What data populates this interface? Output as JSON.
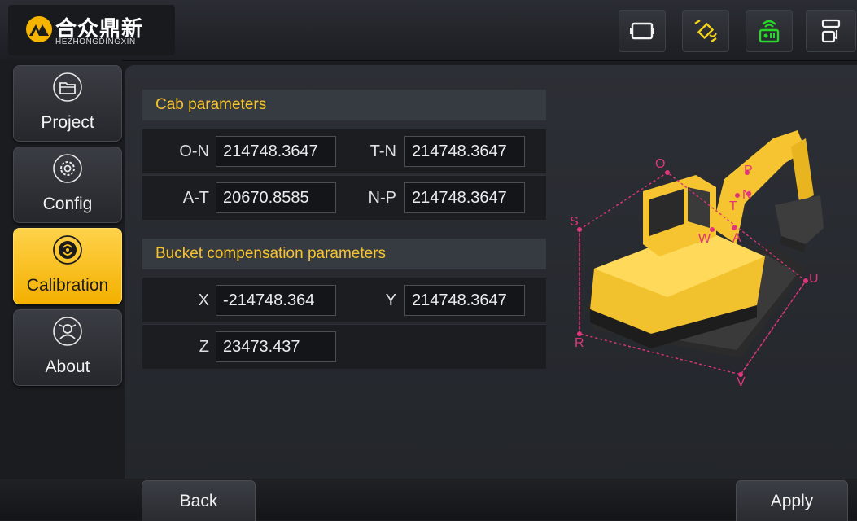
{
  "header": {
    "logo_cn": "合众鼎新",
    "logo_en": "HEZHONGDINGXIN",
    "buttons": [
      {
        "icon": "screen-icon"
      },
      {
        "icon": "satellite-icon"
      },
      {
        "icon": "radio-icon"
      },
      {
        "icon": "switch-icon"
      }
    ]
  },
  "sidebar": {
    "items": [
      {
        "label": "Project",
        "icon": "folder-icon"
      },
      {
        "label": "Config",
        "icon": "settings-icon"
      },
      {
        "label": "Calibration",
        "icon": "calibration-icon",
        "active": true
      },
      {
        "label": "About",
        "icon": "about-icon"
      }
    ]
  },
  "cab": {
    "title": "Cab parameters",
    "on_label": "O-N",
    "on_value": "214748.3647",
    "tn_label": "T-N",
    "tn_value": "214748.3647",
    "at_label": "A-T",
    "at_value": "20670.8585",
    "np_label": "N-P",
    "np_value": "214748.3647"
  },
  "bucket": {
    "title": "Bucket compensation parameters",
    "x_label": "X",
    "x_value": "-214748.364",
    "y_label": "Y",
    "y_value": "214748.3647",
    "z_label": "Z",
    "z_value": "23473.437"
  },
  "diagram": {
    "points": [
      "O",
      "P",
      "T",
      "N",
      "S",
      "W",
      "A",
      "U",
      "R",
      "V"
    ]
  },
  "footer": {
    "back_label": "Back",
    "apply_label": "Apply"
  },
  "colors": {
    "accent": "#f5c430",
    "active_nav": "#fcc41c",
    "marker": "#e0357a"
  }
}
